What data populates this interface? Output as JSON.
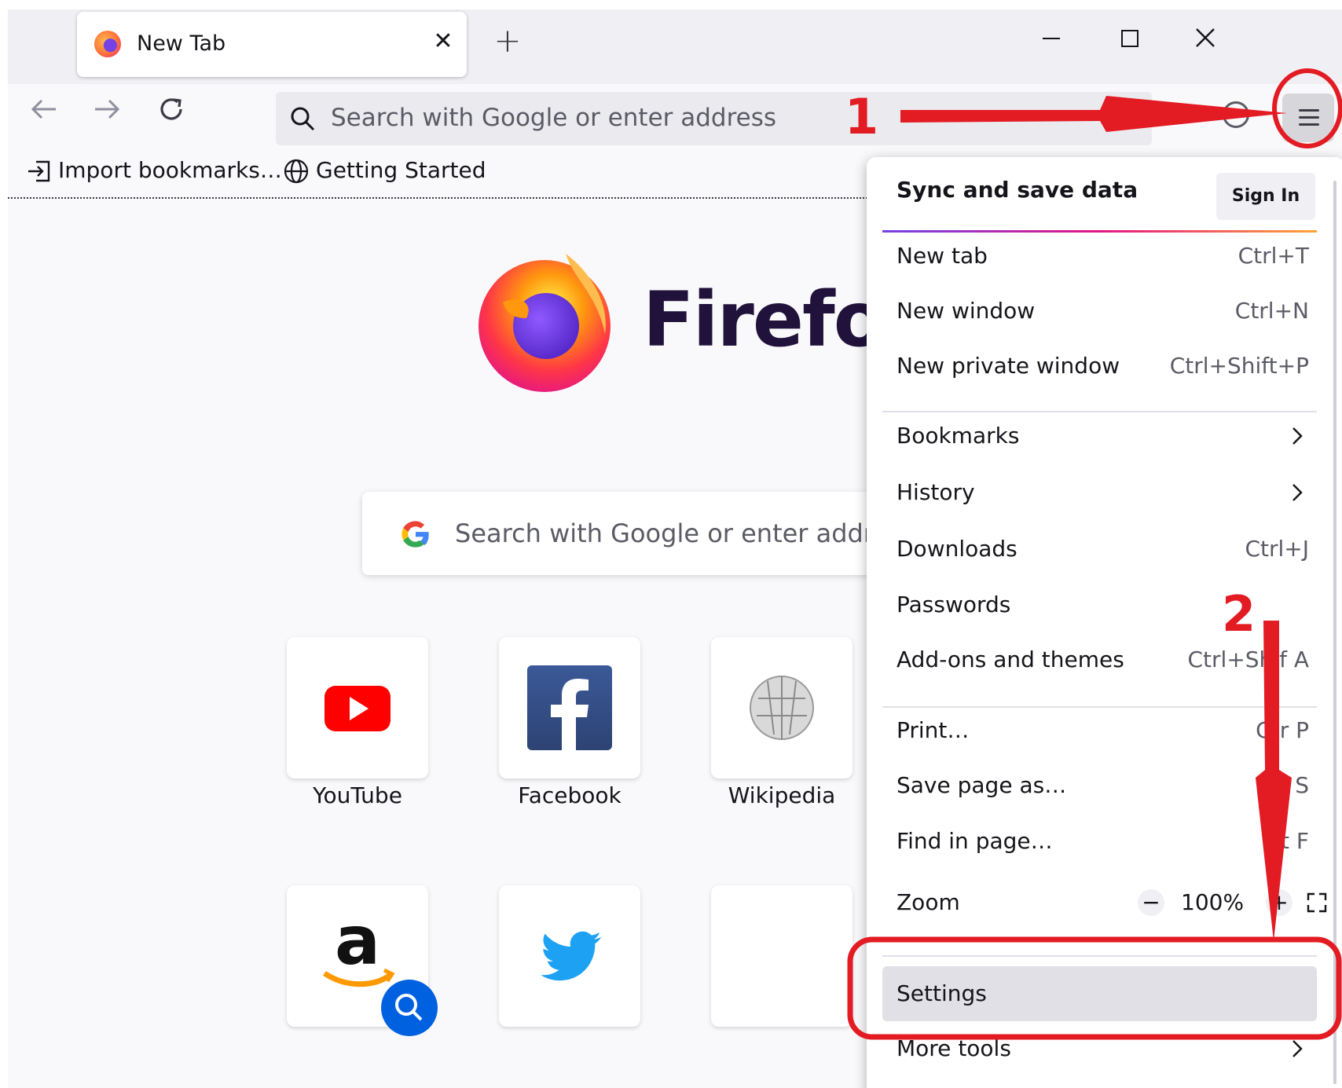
{
  "colors": {
    "accent": "#0061e0",
    "annotation": "#e31b23",
    "menu_highlight": "#e0e0e6"
  },
  "tab": {
    "title": "New Tab",
    "icon": "firefox-icon"
  },
  "navbar": {
    "url_placeholder": "Search with Google or enter address"
  },
  "bookmarks": [
    {
      "label": "Import bookmarks…",
      "icon": "import-icon"
    },
    {
      "label": "Getting Started",
      "icon": "globe-icon"
    }
  ],
  "page": {
    "wordmark": "Firefox",
    "search_placeholder": "Search with Google or enter address",
    "top_sites": [
      {
        "label": "YouTube",
        "icon": "youtube-icon"
      },
      {
        "label": "Facebook",
        "icon": "facebook-icon"
      },
      {
        "label": "Wikipedia",
        "icon": "wikipedia-icon"
      },
      {
        "label": "",
        "icon": "amazon-icon"
      },
      {
        "label": "",
        "icon": "twitter-icon"
      }
    ]
  },
  "menu": {
    "sync_title": "Sync and save data",
    "sign_in": "Sign In",
    "items": [
      {
        "label": "New tab",
        "shortcut": "Ctrl+T"
      },
      {
        "label": "New window",
        "shortcut": "Ctrl+N"
      },
      {
        "label": "New private window",
        "shortcut": "Ctrl+Shift+P"
      },
      {
        "label": "Bookmarks",
        "shortcut": ""
      },
      {
        "label": "History",
        "shortcut": ""
      },
      {
        "label": "Downloads",
        "shortcut": "Ctrl+J"
      },
      {
        "label": "Passwords",
        "shortcut": ""
      },
      {
        "label": "Add-ons and themes",
        "shortcut": "Ctrl+Shif A"
      },
      {
        "label": "Print…",
        "shortcut": "Ctr P"
      },
      {
        "label": "Save page as…",
        "shortcut": "Ct S"
      },
      {
        "label": "Find in page…",
        "shortcut": "Ct F"
      },
      {
        "label": "Zoom",
        "shortcut": ""
      },
      {
        "label": "Settings",
        "shortcut": ""
      },
      {
        "label": "More tools",
        "shortcut": ""
      }
    ],
    "zoom": {
      "minus": "−",
      "value": "100%",
      "plus": "+"
    }
  },
  "annotations": {
    "step1": "1",
    "step2": "2"
  }
}
